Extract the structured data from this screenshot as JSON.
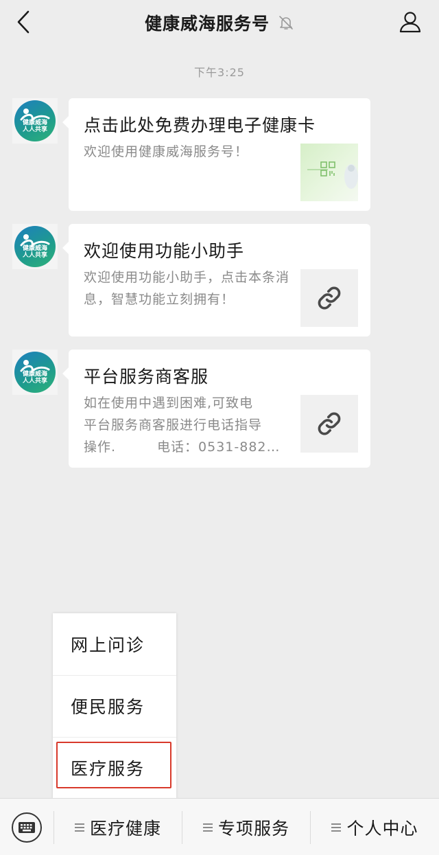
{
  "header": {
    "title": "健康威海服务号"
  },
  "timestamp": "下午3:25",
  "avatar_text": [
    "健康威海",
    "人人共享"
  ],
  "messages": [
    {
      "title": "点击此处免费办理电子健康卡",
      "description": "欢迎使用健康威海服务号！",
      "thumbnail": "health-card-image"
    },
    {
      "title": "欢迎使用功能小助手",
      "description": "欢迎使用功能小助手，点击本条消息，智慧功能立刻拥有！",
      "thumbnail": "link-icon"
    },
    {
      "title": "平台服务商客服",
      "description_lines": [
        "如在使用中遇到困难,可致电",
        "平台服务商客服进行电话指导",
        "操作.　　　电话：0531-882…"
      ],
      "thumbnail": "link-icon"
    }
  ],
  "popup_menu": {
    "items": [
      "网上问诊",
      "便民服务",
      "医疗服务"
    ],
    "highlighted": "医疗服务",
    "highlight_color": "#d8392b"
  },
  "bottom_bar": {
    "items": [
      "医疗健康",
      "专项服务",
      "个人中心"
    ]
  }
}
